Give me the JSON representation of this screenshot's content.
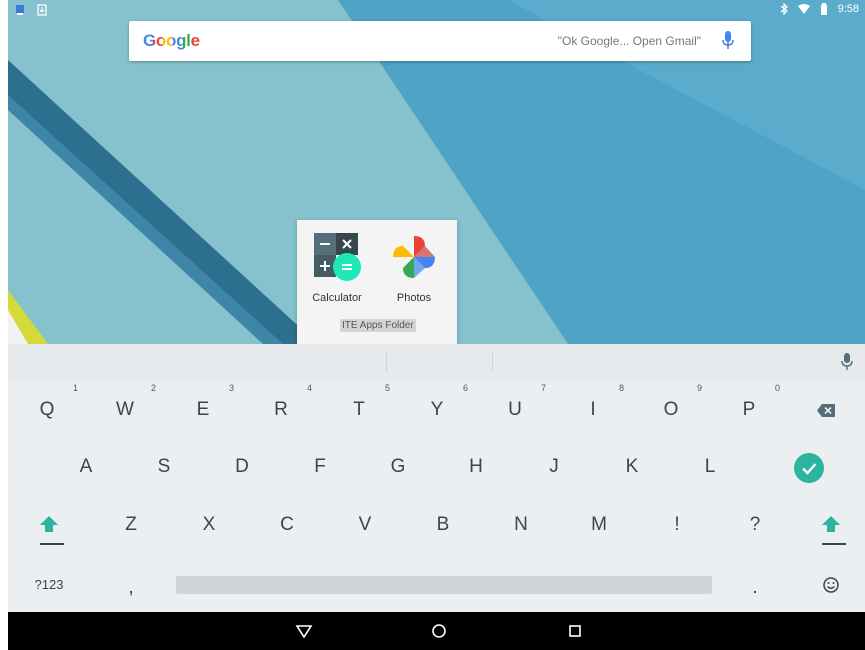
{
  "status_bar": {
    "time": "9:58",
    "left_icons": [
      "notification-app-icon",
      "download-icon"
    ],
    "right_icons": [
      "bluetooth-icon",
      "wifi-icon",
      "battery-icon"
    ]
  },
  "search": {
    "logo": "Google",
    "hint": "\"Ok Google... Open Gmail\"",
    "mic_icon": "mic-icon"
  },
  "folder": {
    "name": "ITE Apps Folder",
    "apps": [
      {
        "label": "Calculator",
        "icon": "calculator-icon"
      },
      {
        "label": "Photos",
        "icon": "photos-icon"
      }
    ]
  },
  "keyboard": {
    "row1": [
      {
        "key": "Q",
        "hint": "1"
      },
      {
        "key": "W",
        "hint": "2"
      },
      {
        "key": "E",
        "hint": "3"
      },
      {
        "key": "R",
        "hint": "4"
      },
      {
        "key": "T",
        "hint": "5"
      },
      {
        "key": "Y",
        "hint": "6"
      },
      {
        "key": "U",
        "hint": "7"
      },
      {
        "key": "I",
        "hint": "8"
      },
      {
        "key": "O",
        "hint": "9"
      },
      {
        "key": "P",
        "hint": "0"
      }
    ],
    "row2": [
      "A",
      "S",
      "D",
      "F",
      "G",
      "H",
      "J",
      "K",
      "L"
    ],
    "row3": [
      "Z",
      "X",
      "C",
      "V",
      "B",
      "N",
      "M",
      "!",
      "?"
    ],
    "row4": {
      "symbols": "?123",
      "comma": ",",
      "period": "."
    },
    "icons": {
      "backspace": "backspace-icon",
      "enter": "enter-check-icon",
      "shift": "shift-icon",
      "emoji": "emoji-icon",
      "mic": "mic-icon"
    },
    "accent_color": "#2bb5a0"
  },
  "nav_bar": {
    "buttons": [
      "back-icon",
      "home-icon",
      "recents-icon"
    ]
  }
}
